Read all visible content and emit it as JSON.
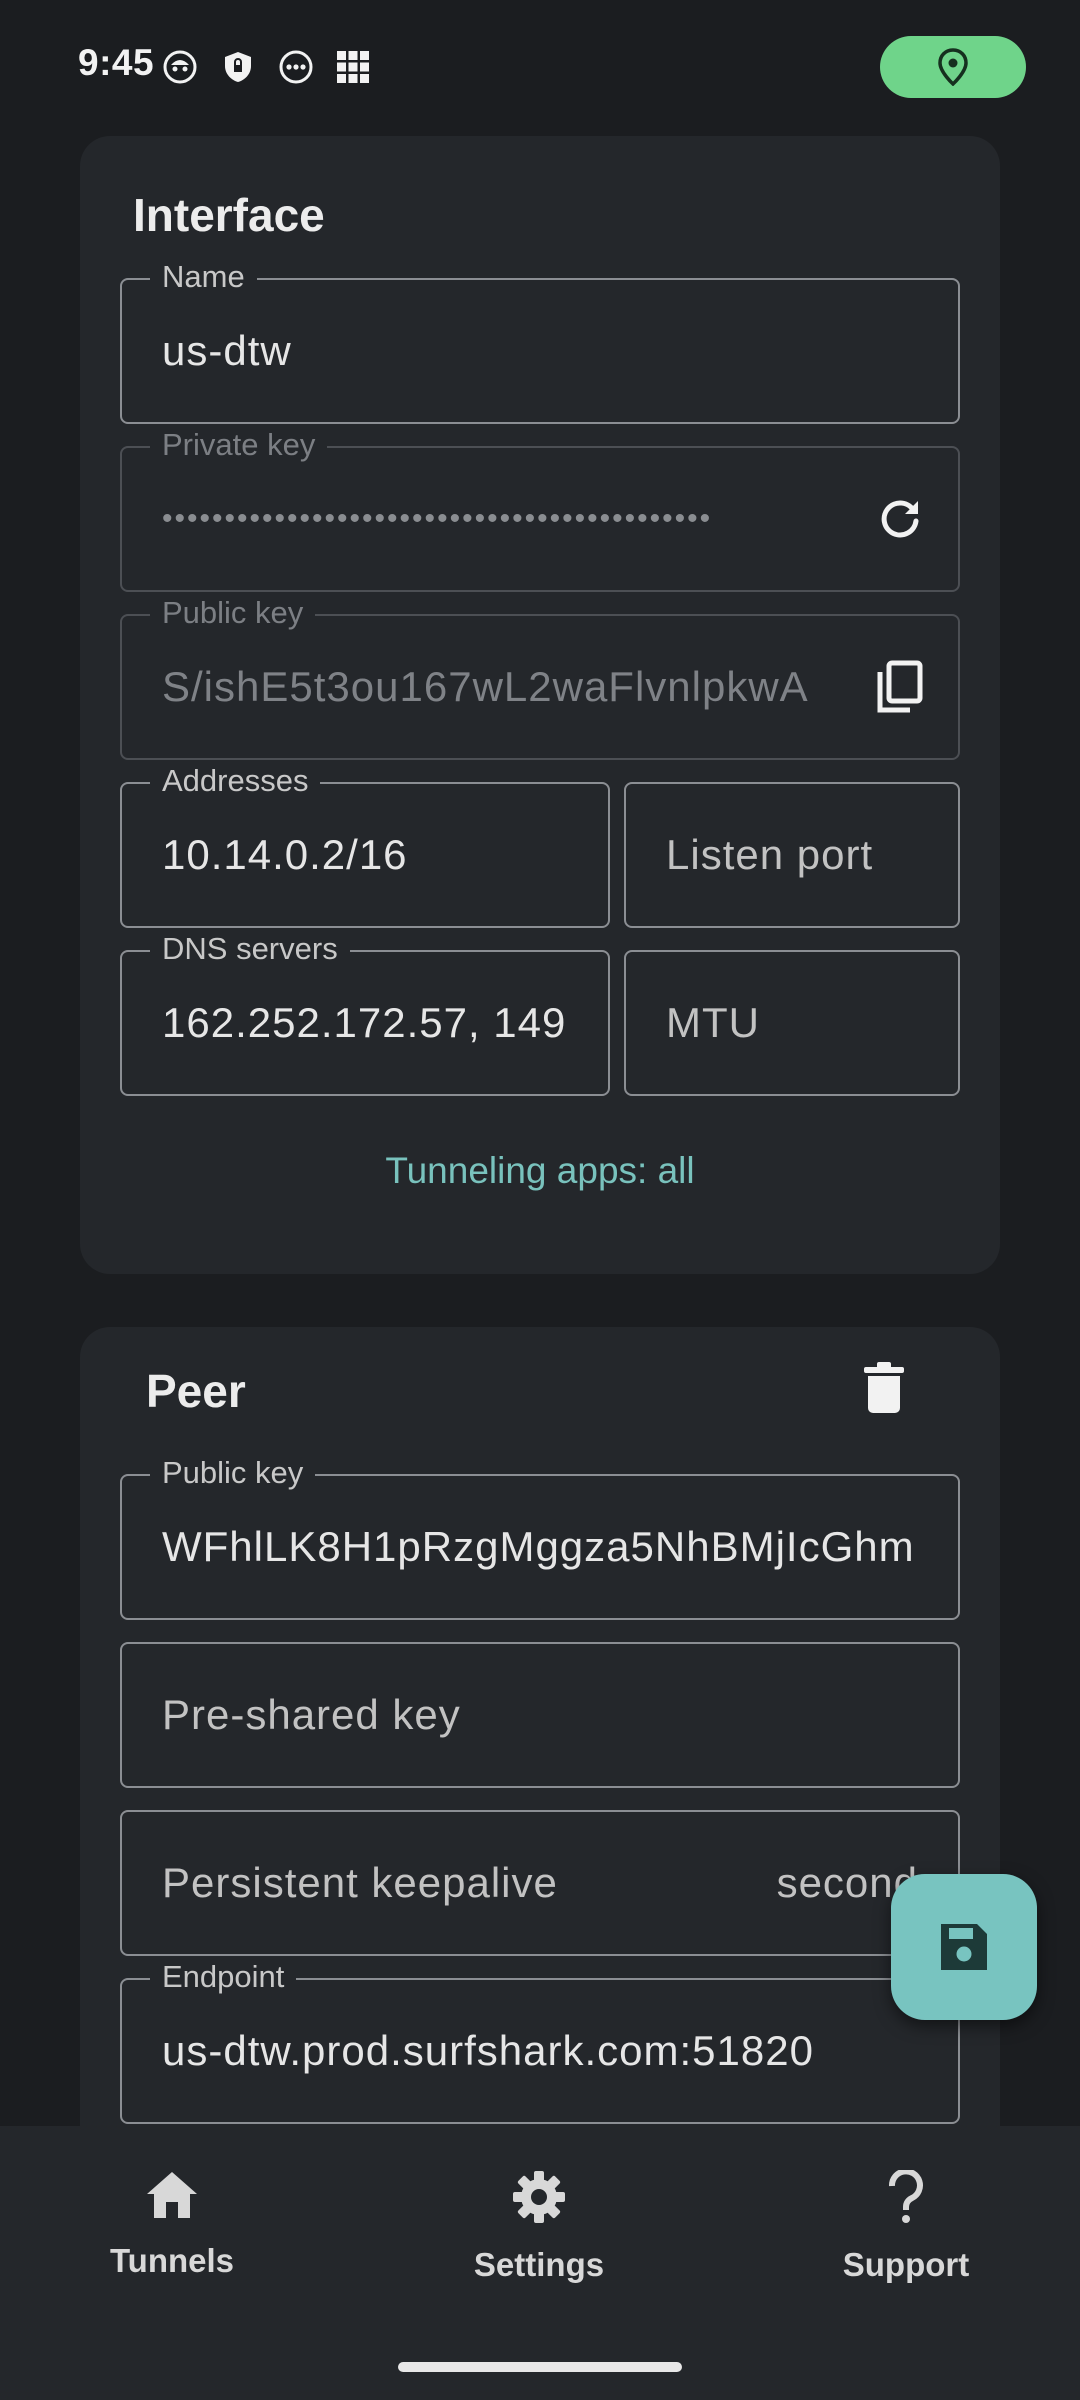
{
  "status_bar": {
    "time": "9:45",
    "icons": [
      "face-notification-icon",
      "vpn-key-shield-icon",
      "more-dots-icon",
      "grid-apps-icon"
    ],
    "location_pill_color": "#6fd48a"
  },
  "interface": {
    "title": "Interface",
    "name": {
      "label": "Name",
      "value": "us-dtw"
    },
    "private_key": {
      "label": "Private key",
      "value": "••••••••••••••••••••••••••••••••••••••••••••"
    },
    "public_key": {
      "label": "Public key",
      "value": "S/ishE5t3ou167wL2waFlvnlpkwA"
    },
    "addresses": {
      "label": "Addresses",
      "value": "10.14.0.2/16"
    },
    "listen_port": {
      "placeholder": "Listen port"
    },
    "dns_servers": {
      "label": "DNS servers",
      "value": "162.252.172.57, 149"
    },
    "mtu": {
      "placeholder": "MTU"
    },
    "tunneling_apps": "Tunneling apps: all"
  },
  "peer": {
    "title": "Peer",
    "public_key": {
      "label": "Public key",
      "value": "WFhlLK8H1pRzgMggza5NhBMjIcGhm"
    },
    "preshared_key": {
      "placeholder": "Pre-shared key"
    },
    "persistent_keepalive": {
      "placeholder": "Persistent keepalive",
      "suffix": "second"
    },
    "endpoint": {
      "label": "Endpoint",
      "value": "us-dtw.prod.surfshark.com:51820"
    }
  },
  "fab": {
    "icon": "save-icon",
    "color": "#78c4c0"
  },
  "bottom_nav": {
    "items": [
      {
        "label": "Tunnels",
        "icon": "home-icon"
      },
      {
        "label": "Settings",
        "icon": "gear-icon"
      },
      {
        "label": "Support",
        "icon": "question-icon"
      }
    ]
  }
}
